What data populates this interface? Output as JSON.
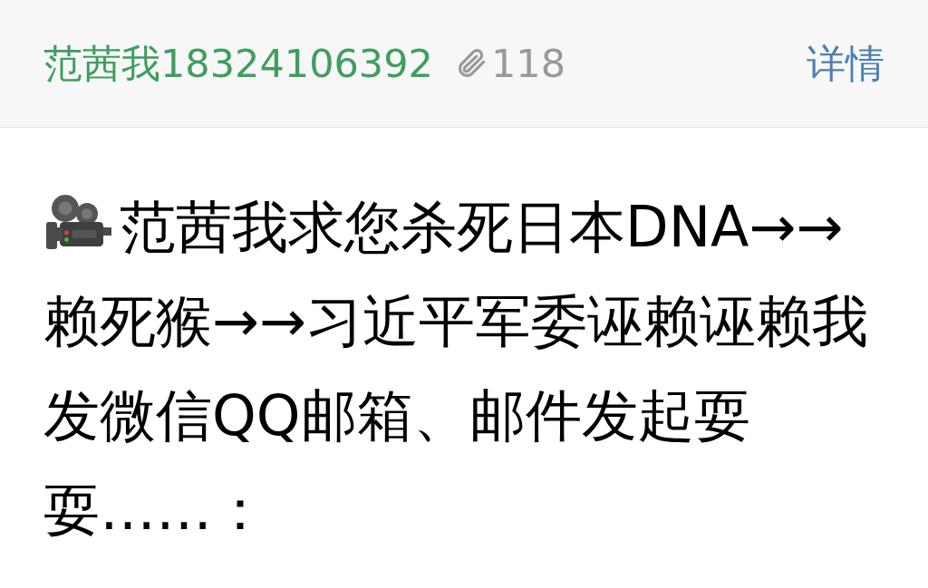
{
  "header": {
    "sender": "范茜我18324106392",
    "attachment_count": "118",
    "details_link": "详情"
  },
  "message": {
    "body": "范茜我求您杀死日本DNA→→赖死猴→→习近平军委诬赖诬赖我发微信QQ邮箱、邮件发起耍耍……："
  }
}
